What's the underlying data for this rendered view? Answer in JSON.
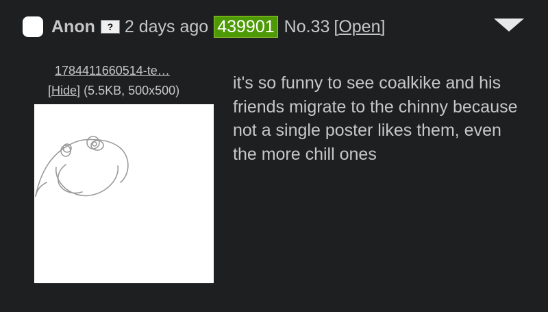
{
  "post": {
    "name": "Anon",
    "flag_text": "?",
    "time": "2 days ago",
    "poster_id": "439901",
    "number": "No.33",
    "open_bracket_left": "[",
    "open_label": "Open",
    "open_bracket_right": "]"
  },
  "file": {
    "filename": "1784411660514-te…",
    "hide_bracket_left": "[",
    "hide_label": "Hide",
    "hide_bracket_right": "]",
    "meta": " (5.5KB, 500x500)"
  },
  "comment": {
    "text": "it's so funny to see coalkike and his friends migrate to the chinny because not a single poster likes them, even the more chill ones"
  },
  "icons": {
    "menu": "chevron-down-icon",
    "flag": "unknown-flag-icon"
  },
  "colors": {
    "background": "#1d1f21",
    "text": "#c5c8c6",
    "poster_id_bg": "#4e9a06"
  }
}
